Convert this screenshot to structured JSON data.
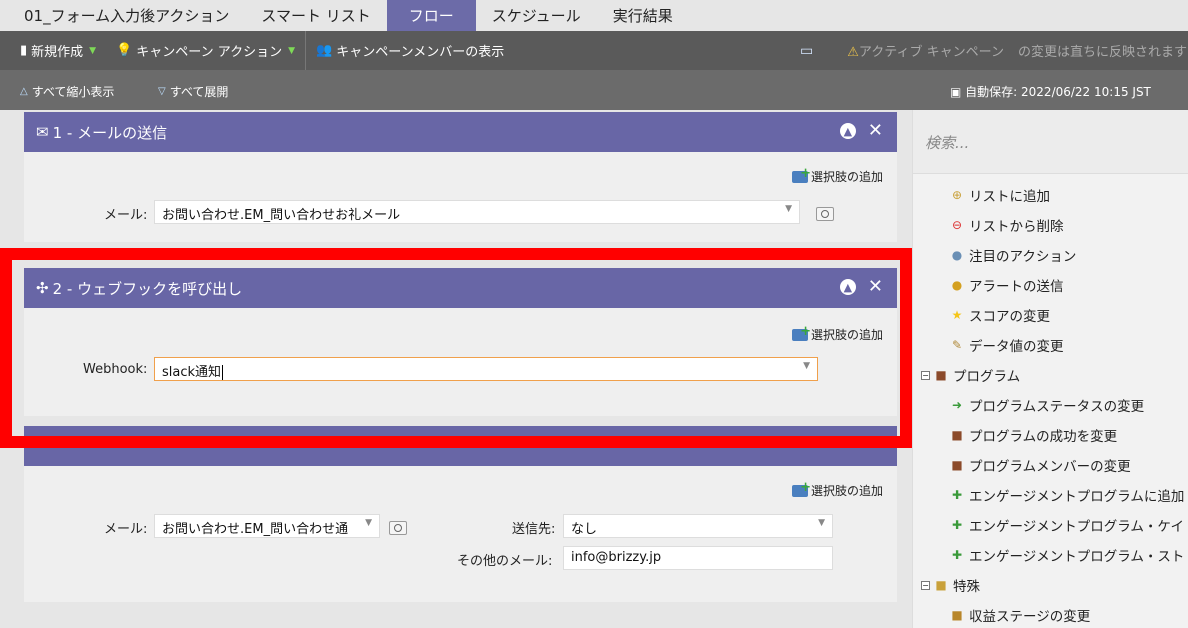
{
  "tabs": [
    {
      "label": "01_フォーム入力後アクション"
    },
    {
      "label": "スマート リスト"
    },
    {
      "label": "フロー"
    },
    {
      "label": "スケジュール"
    },
    {
      "label": "実行結果"
    }
  ],
  "toolbar": {
    "new_label": "新規作成",
    "campaign_action_label": "キャンペーン アクション",
    "show_members_label": "キャンペーンメンバーの表示",
    "active_notice": "アクティブ キャンペーン",
    "active_notice_suffix": "の変更は直ちに反映されます"
  },
  "subbar": {
    "collapse_all": "すべて縮小表示",
    "expand_all": "すべて展開",
    "autosave": "自動保存: 2022/06/22 10:15 JST"
  },
  "steps": {
    "step1": {
      "title": "1 - メールの送信",
      "add_choice": "選択肢の追加",
      "email_label": "メール:",
      "email_value": "お問い合わせ.EM_問い合わせお礼メール"
    },
    "step2": {
      "title": "2 - ウェブフックを呼び出し",
      "add_choice": "選択肢の追加",
      "webhook_label": "Webhook:",
      "webhook_value": "slack通知"
    },
    "step3": {
      "add_choice": "選択肢の追加",
      "email_label": "メール:",
      "email_value": "お問い合わせ.EM_問い合わせ通",
      "send_to_label": "送信先:",
      "send_to_value": "なし",
      "other_email_label": "その他のメール:",
      "other_email_value": "info@brizzy.jp"
    }
  },
  "panel": {
    "search_placeholder": "検索...",
    "items": [
      {
        "label": "リストに追加"
      },
      {
        "label": "リストから削除"
      },
      {
        "label": "注目のアクション"
      },
      {
        "label": "アラートの送信"
      },
      {
        "label": "スコアの変更"
      },
      {
        "label": "データ値の変更"
      },
      {
        "label": "プログラム"
      },
      {
        "label": "プログラムステータスの変更"
      },
      {
        "label": "プログラムの成功を変更"
      },
      {
        "label": "プログラムメンバーの変更"
      },
      {
        "label": "エンゲージメントプログラムに追加"
      },
      {
        "label": "エンゲージメントプログラム・ケイ"
      },
      {
        "label": "エンゲージメントプログラム・スト"
      },
      {
        "label": "特殊"
      },
      {
        "label": "収益ステージの変更"
      }
    ]
  },
  "colors": {
    "accent": "#6866a6",
    "highlight": "#ff0000",
    "toolbar": "#5a5a5a"
  }
}
